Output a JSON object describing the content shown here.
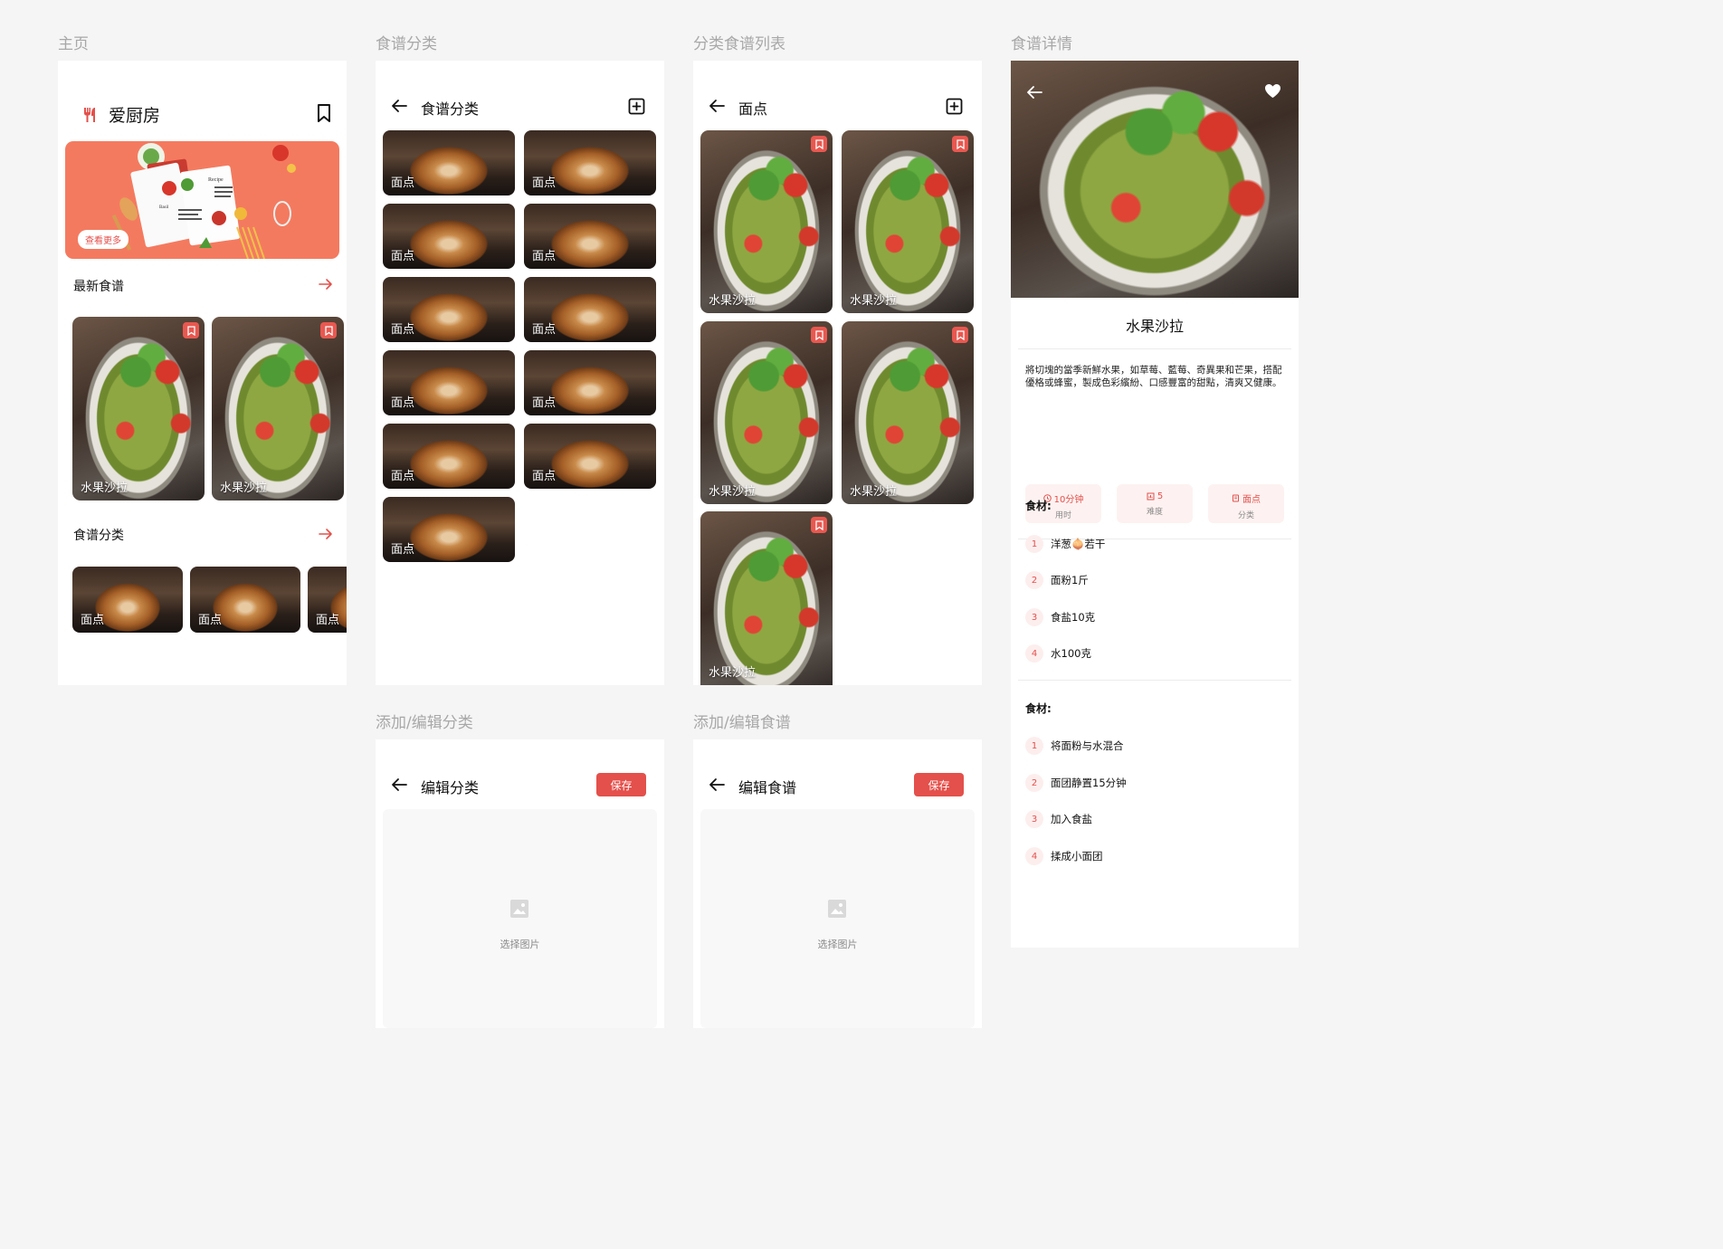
{
  "labels": {
    "home": "主页",
    "categories": "食谱分类",
    "category_list": "分类食谱列表",
    "detail": "食谱详情",
    "edit_category": "添加/编辑分类",
    "edit_recipe": "添加/编辑食谱"
  },
  "home": {
    "app_title": "爱厨房",
    "banner_button": "查看更多",
    "banner_book_words": [
      "Recipe",
      "Basil"
    ],
    "latest_title": "最新食谱",
    "latest_items": [
      "水果沙拉",
      "水果沙拉"
    ],
    "category_title": "食谱分类",
    "category_items": [
      "面点",
      "面点",
      "面点"
    ]
  },
  "categories": {
    "title": "食谱分类",
    "items": [
      "面点",
      "面点",
      "面点",
      "面点",
      "面点",
      "面点",
      "面点",
      "面点",
      "面点",
      "面点",
      "面点"
    ]
  },
  "category_list": {
    "title": "面点",
    "items": [
      "水果沙拉",
      "水果沙拉",
      "水果沙拉",
      "水果沙拉",
      "水果沙拉"
    ]
  },
  "detail": {
    "name": "水果沙拉",
    "description": "將切塊的當季新鮮水果，如草莓、藍莓、奇異果和芒果，搭配優格或蜂蜜，製成色彩繽紛、口感豐富的甜點，清爽又健康。",
    "stats": [
      {
        "value": "10分钟",
        "key": "用时",
        "icon": "clock-icon"
      },
      {
        "value": "5",
        "key": "难度",
        "icon": "chart-icon"
      },
      {
        "value": "面点",
        "key": "分类",
        "icon": "book-icon"
      }
    ],
    "ingredients_title": "食材:",
    "ingredients": [
      {
        "n": "1",
        "text": "洋葱🧅若干"
      },
      {
        "n": "2",
        "text": "面粉1斤"
      },
      {
        "n": "3",
        "text": "食盐10克"
      },
      {
        "n": "4",
        "text": "水100克"
      }
    ],
    "steps_title": "食材:",
    "steps": [
      {
        "n": "1",
        "text": "将面粉与水混合"
      },
      {
        "n": "2",
        "text": "面团静置15分钟"
      },
      {
        "n": "3",
        "text": "加入食盐"
      },
      {
        "n": "4",
        "text": "揉成小面团"
      }
    ]
  },
  "edit_category": {
    "title": "编辑分类",
    "save": "保存",
    "pick_image": "选择图片"
  },
  "edit_recipe": {
    "title": "编辑食谱",
    "save": "保存",
    "pick_image": "选择图片"
  },
  "colors": {
    "accent": "#e4504b",
    "banner": "#f47a5f",
    "page_bg": "#f5f5f5"
  }
}
